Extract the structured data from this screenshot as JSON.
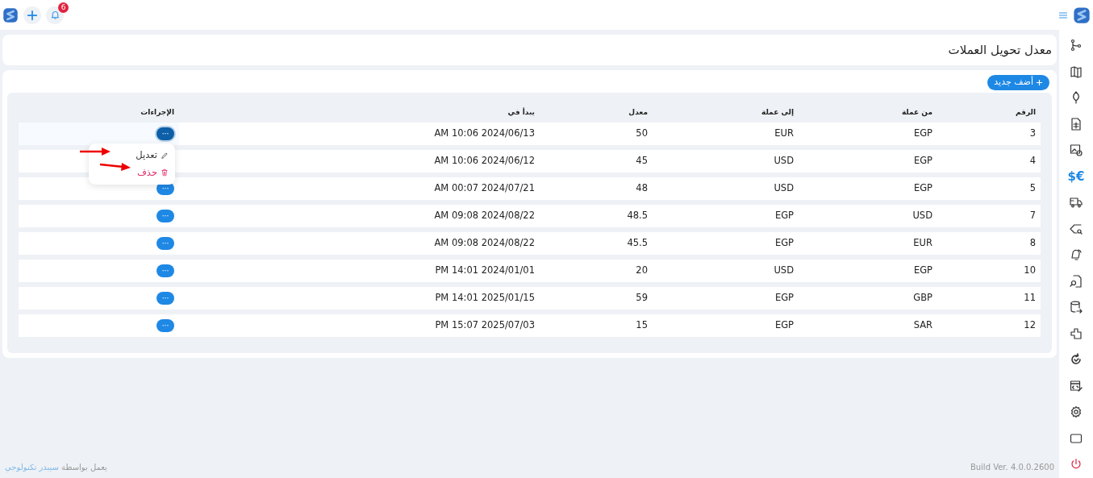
{
  "topbar": {
    "notification_count": "6"
  },
  "sidebar": {
    "items": [
      {
        "kind": "icon",
        "selected": false
      },
      {
        "kind": "icon",
        "selected": false
      },
      {
        "kind": "icon",
        "selected": false
      },
      {
        "kind": "icon",
        "selected": false
      },
      {
        "kind": "icon",
        "selected": false
      },
      {
        "kind": "text",
        "label": "$€",
        "selected": true
      },
      {
        "kind": "icon",
        "selected": false
      },
      {
        "kind": "icon",
        "selected": false
      },
      {
        "kind": "icon",
        "selected": false
      },
      {
        "kind": "icon",
        "selected": false
      },
      {
        "kind": "icon",
        "selected": false
      },
      {
        "kind": "icon",
        "selected": false
      },
      {
        "kind": "icon",
        "selected": false
      },
      {
        "kind": "icon",
        "selected": false
      },
      {
        "kind": "icon",
        "selected": false
      },
      {
        "kind": "icon",
        "selected": false
      },
      {
        "kind": "icon",
        "selected": false
      }
    ]
  },
  "page_title": "معدل تحويل العملات",
  "add_button": "أضف جديد",
  "table": {
    "columns": [
      "الإجراءات",
      "يبدأ في",
      "معدل",
      "إلى عملة",
      "من عملة",
      "الرقم"
    ],
    "rows": [
      {
        "cells": [
          "···",
          "AM 10:06 2024/06/13",
          "50",
          "EUR",
          "EGP",
          "3"
        ],
        "menu_open": true,
        "menu": [
          {
            "kind": "edit",
            "label": "تعديل"
          },
          {
            "kind": "delete",
            "label": "حذف"
          }
        ]
      },
      {
        "cells": [
          "",
          "AM 10:06 2024/06/12",
          "45",
          "USD",
          "EGP",
          "4"
        ],
        "menu_open": false
      },
      {
        "cells": [
          "···",
          "AM 00:07 2024/07/21",
          "48",
          "USD",
          "EGP",
          "5"
        ],
        "menu_open": false
      },
      {
        "cells": [
          "···",
          "AM 09:08 2024/08/22",
          "48.5",
          "EGP",
          "USD",
          "7"
        ],
        "menu_open": false
      },
      {
        "cells": [
          "···",
          "AM 09:08 2024/08/22",
          "45.5",
          "EGP",
          "EUR",
          "8"
        ],
        "menu_open": false
      },
      {
        "cells": [
          "···",
          "PM 14:01 2024/01/01",
          "20",
          "USD",
          "EGP",
          "10"
        ],
        "menu_open": false
      },
      {
        "cells": [
          "···",
          "PM 14:01 2025/01/15",
          "59",
          "EGP",
          "GBP",
          "11"
        ],
        "menu_open": false
      },
      {
        "cells": [
          "···",
          "PM 15:07 2025/07/03",
          "15",
          "EGP",
          "SAR",
          "12"
        ],
        "menu_open": false
      }
    ]
  },
  "footer": {
    "powered_by": "يعمل بواسطة",
    "company": "سيبدر تكنولوجي",
    "build": "Build Ver. 4.0.0.2600"
  }
}
